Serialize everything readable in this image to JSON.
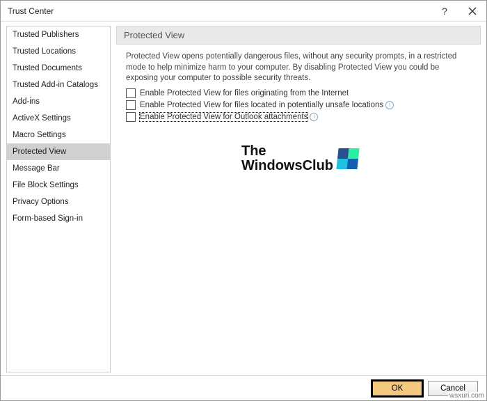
{
  "dialog": {
    "title": "Trust Center",
    "help_tooltip": "?",
    "close_tooltip": "Close"
  },
  "sidebar": {
    "items": [
      {
        "label": "Trusted Publishers",
        "selected": false
      },
      {
        "label": "Trusted Locations",
        "selected": false
      },
      {
        "label": "Trusted Documents",
        "selected": false
      },
      {
        "label": "Trusted Add-in Catalogs",
        "selected": false
      },
      {
        "label": "Add-ins",
        "selected": false
      },
      {
        "label": "ActiveX Settings",
        "selected": false
      },
      {
        "label": "Macro Settings",
        "selected": false
      },
      {
        "label": "Protected View",
        "selected": true
      },
      {
        "label": "Message Bar",
        "selected": false
      },
      {
        "label": "File Block Settings",
        "selected": false
      },
      {
        "label": "Privacy Options",
        "selected": false
      },
      {
        "label": "Form-based Sign-in",
        "selected": false
      }
    ]
  },
  "main": {
    "header": "Protected View",
    "description": "Protected View opens potentially dangerous files, without any security prompts, in a restricted mode to help minimize harm to your computer. By disabling Protected View you could be exposing your computer to possible security threats.",
    "options": [
      {
        "label": "Enable Protected View for files originating from the Internet",
        "checked": false,
        "info": false,
        "focused": false
      },
      {
        "label": "Enable Protected View for files located in potentially unsafe locations",
        "checked": false,
        "info": true,
        "focused": false
      },
      {
        "label": "Enable Protected View for Outlook attachments",
        "checked": false,
        "info": true,
        "focused": true
      }
    ]
  },
  "watermark": {
    "line1": "The",
    "line2": "WindowsClub"
  },
  "footer": {
    "ok": "OK",
    "cancel": "Cancel"
  },
  "corner": "wsxuri.com"
}
